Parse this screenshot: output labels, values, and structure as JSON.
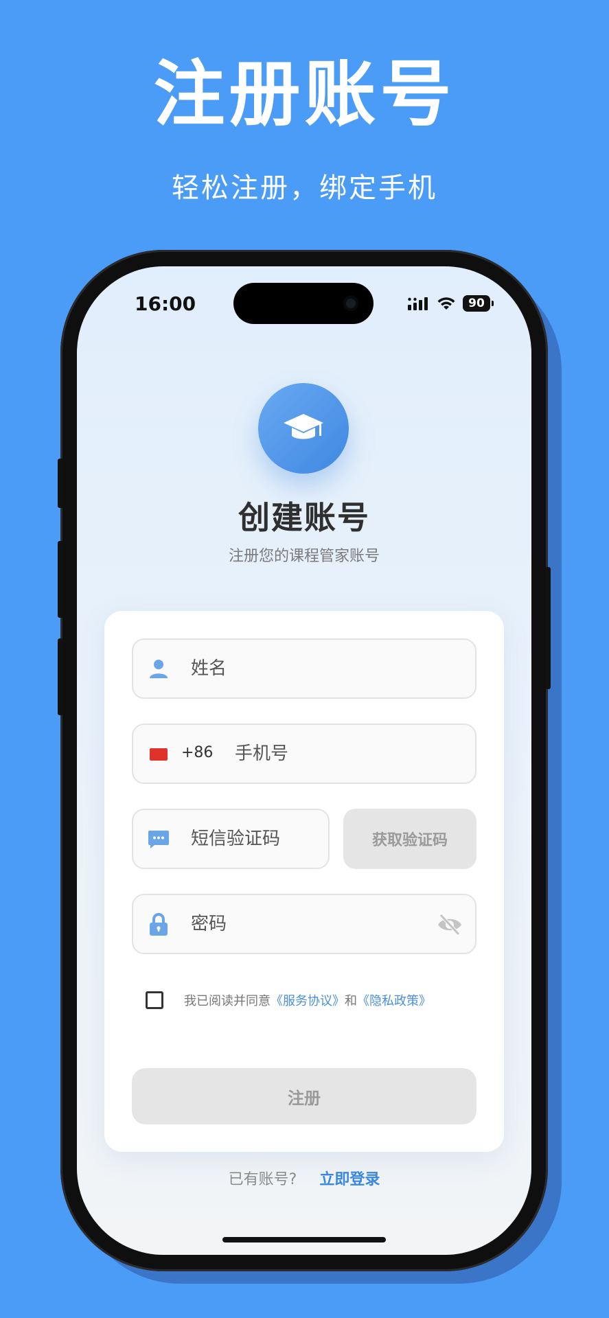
{
  "hero": {
    "title": "注册账号",
    "subtitle": "轻松注册，绑定手机"
  },
  "status_bar": {
    "time": "16:00",
    "battery": "90"
  },
  "screen": {
    "logo_icon": "graduation-cap-icon",
    "title": "创建账号",
    "subtitle": "注册您的课程管家账号"
  },
  "form": {
    "name_placeholder": "姓名",
    "country_code": "+86",
    "phone_placeholder": "手机号",
    "sms_placeholder": "短信验证码",
    "get_code_label": "获取验证码",
    "password_placeholder": "密码",
    "agree_prefix": "我已阅读并同意",
    "service_agreement": "《服务协议》",
    "agree_and": "和",
    "privacy_policy": "《隐私政策》",
    "submit_label": "注册"
  },
  "footer": {
    "login_prompt": "已有账号?",
    "login_link": "立即登录"
  },
  "colors": {
    "background": "#4a9cf6",
    "accent": "#4a8fdc",
    "icon": "#6aa5e8",
    "disabled_button": "#e5e5e5"
  }
}
